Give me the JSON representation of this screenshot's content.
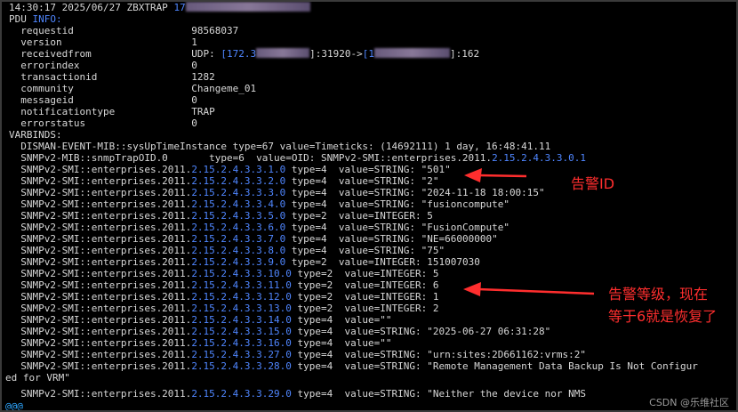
{
  "lines": {
    "l00a": "14:30:17 2025/06/27 ZBXTRAP ",
    "l00b": "17",
    "l01a": "PDU ",
    "l01b": "INFO:",
    "l02": "  requestid                    98568037",
    "l03": "  version                      1",
    "l04a": "  receivedfrom                 UDP: ",
    "l04b": "[172.3",
    "l04c": "]:31920->",
    "l04d": "[1",
    "l04e": "]:162",
    "l05": "  errorindex                   0",
    "l06": "  transactionid                1282",
    "l07": "  community                    Changeme_01",
    "l08": "  messageid                    0",
    "l09": "  notificationtype             TRAP",
    "l10": "  errorstatus                  0",
    "l11": "VARBINDS:",
    "l12": "  DISMAN-EVENT-MIB::sysUpTimeInstance type=67 value=Timeticks: (14692111) 1 day, 16:48:41.11",
    "l13a": "  SNMPv2-MIB::snmpTrapOID.0       type=6  value=OID: SNMPv2-SMI::enterprises.2011.",
    "l13b": "2.15.2.4.3.3.0.1",
    "l14a": "  SNMPv2-SMI::enterprises.2011.",
    "l14b": "2.15.2.4.3.3.1.0",
    "l14c": " type=4  value=STRING: \"501\"",
    "l15a": "  SNMPv2-SMI::enterprises.2011.",
    "l15b": "2.15.2.4.3.3.2.0",
    "l15c": " type=4  value=STRING: \"2\"",
    "l16a": "  SNMPv2-SMI::enterprises.2011.",
    "l16b": "2.15.2.4.3.3.3.0",
    "l16c": " type=4  value=STRING: \"2024-11-18 18:00:15\"",
    "l17a": "  SNMPv2-SMI::enterprises.2011.",
    "l17b": "2.15.2.4.3.3.4.0",
    "l17c": " type=4  value=STRING: \"fusioncompute\"",
    "l18a": "  SNMPv2-SMI::enterprises.2011.",
    "l18b": "2.15.2.4.3.3.5.0",
    "l18c": " type=2  value=INTEGER: 5",
    "l19a": "  SNMPv2-SMI::enterprises.2011.",
    "l19b": "2.15.2.4.3.3.6.0",
    "l19c": " type=4  value=STRING: \"FusionCompute\"",
    "l20a": "  SNMPv2-SMI::enterprises.2011.",
    "l20b": "2.15.2.4.3.3.7.0",
    "l20c": " type=4  value=STRING: \"NE=66000000\"",
    "l21a": "  SNMPv2-SMI::enterprises.2011.",
    "l21b": "2.15.2.4.3.3.8.0",
    "l21c": " type=4  value=STRING: \"75\"",
    "l22a": "  SNMPv2-SMI::enterprises.2011.",
    "l22b": "2.15.2.4.3.3.9.0",
    "l22c": " type=2  value=INTEGER: 151007030",
    "l23a": "  SNMPv2-SMI::enterprises.2011.",
    "l23b": "2.15.2.4.3.3.10.0",
    "l23c": " type=2  value=INTEGER: 5",
    "l24a": "  SNMPv2-SMI::enterprises.2011.",
    "l24b": "2.15.2.4.3.3.11.0",
    "l24c": " type=2  value=INTEGER: 6",
    "l25a": "  SNMPv2-SMI::enterprises.2011.",
    "l25b": "2.15.2.4.3.3.12.0",
    "l25c": " type=2  value=INTEGER: 1",
    "l26a": "  SNMPv2-SMI::enterprises.2011.",
    "l26b": "2.15.2.4.3.3.13.0",
    "l26c": " type=2  value=INTEGER: 2",
    "l27a": "  SNMPv2-SMI::enterprises.2011.",
    "l27b": "2.15.2.4.3.3.14.0",
    "l27c": " type=4  value=\"\"",
    "l28a": "  SNMPv2-SMI::enterprises.2011.",
    "l28b": "2.15.2.4.3.3.15.0",
    "l28c": " type=4  value=STRING: \"2025-06-27 06:31:28\"",
    "l29a": "  SNMPv2-SMI::enterprises.2011.",
    "l29b": "2.15.2.4.3.3.16.0",
    "l29c": " type=4  value=\"\"",
    "l30a": "  SNMPv2-SMI::enterprises.2011.",
    "l30b": "2.15.2.4.3.3.27.0",
    "l30c": " type=4  value=STRING: \"urn:sites:2D661162:vrms:2\"",
    "l31a": "  SNMPv2-SMI::enterprises.2011.",
    "l31b": "2.15.2.4.3.3.28.0",
    "l31c": " type=4  value=STRING: \"Remote Management Data Backup Is Not Configur",
    "l32": "ed for VRM\"",
    "l33a": "  SNMPv2-SMI::enterprises.2011.",
    "l33b": "2.15.2.4.3.3.29.0",
    "l33c": " type=4  value=STRING: \"Neither the device nor NMS",
    "l34": "@@@"
  },
  "annotations": {
    "alarm_id": "告警ID",
    "alarm_level_1": "告警等级，现在",
    "alarm_level_2": "等于6就是恢复了"
  },
  "watermark": "CSDN @乐维社区",
  "colors": {
    "accent_arrow": "#ff2e2e",
    "oid_blue": "#4f86ff"
  }
}
